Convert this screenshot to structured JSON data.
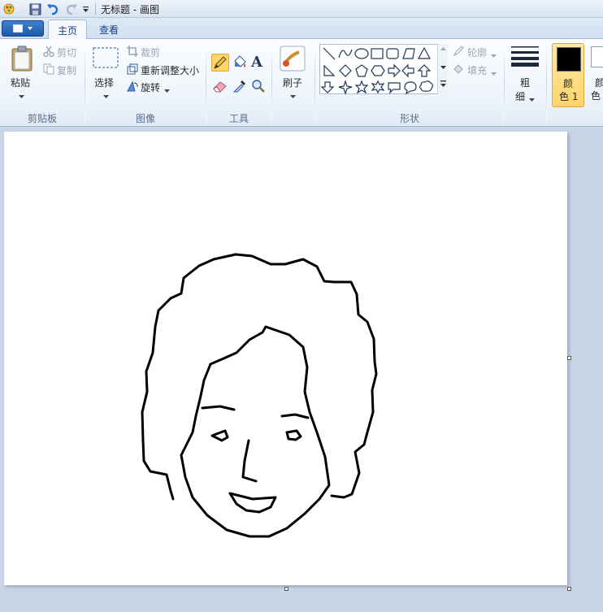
{
  "window": {
    "title": "无标题 - 画图"
  },
  "tabs": [
    {
      "label": "主页",
      "active": true
    },
    {
      "label": "查看",
      "active": false
    }
  ],
  "clipboard": {
    "paste": "粘贴",
    "cut": "剪切",
    "copy": "复制",
    "group": "剪贴板"
  },
  "image": {
    "select": "选择",
    "crop": "裁剪",
    "resize": "重新调整大小",
    "rotate": "旋转",
    "group": "图像"
  },
  "tools": {
    "group": "工具",
    "text_glyph": "A"
  },
  "brushes": {
    "label": "刷子"
  },
  "shapes": {
    "outline": "轮廓",
    "fill": "填充",
    "group": "形状"
  },
  "size": {
    "label_line1": "粗",
    "label_line2": "细"
  },
  "colors": {
    "color1_line1": "颜",
    "color1_line2": "色 1",
    "color2_line1": "颜",
    "color2_line2": "色"
  },
  "accent": {
    "selected_tool": "#ffd46a",
    "title_icon": "#1e5aa8"
  }
}
